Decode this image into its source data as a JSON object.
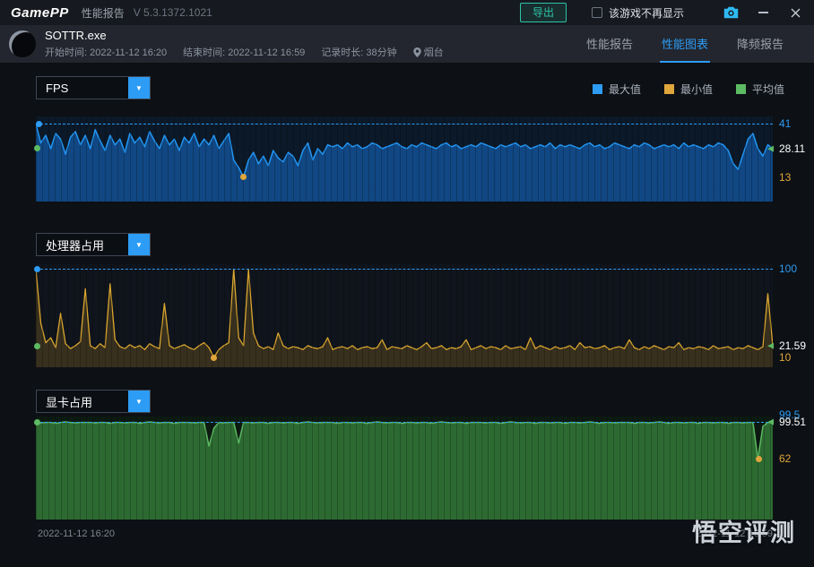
{
  "titlebar": {
    "logo": "GamePP",
    "app_label": "性能报告",
    "version": "V 5.3.1372.1021",
    "export_label": "导出",
    "hide_game_label": "该游戏不再显示"
  },
  "header": {
    "game_name": "SOTTR.exe",
    "start_time": "开始时间: 2022-11-12 16:20",
    "end_time": "结束时间: 2022-11-12 16:59",
    "duration": "记录时长: 38分钟",
    "location": "烟台",
    "tabs": [
      {
        "label": "性能报告",
        "active": false
      },
      {
        "label": "性能图表",
        "active": true
      },
      {
        "label": "降频报告",
        "active": false
      }
    ]
  },
  "selectors": [
    {
      "value": "FPS"
    },
    {
      "value": "处理器占用"
    },
    {
      "value": "显卡占用"
    }
  ],
  "legend": {
    "items": [
      {
        "label": "最大值",
        "color": "#2d9cf4"
      },
      {
        "label": "最小值",
        "color": "#e0a63c"
      },
      {
        "label": "平均值",
        "color": "#5dbb63"
      }
    ]
  },
  "x_axis": {
    "left": "2022-11-12 16:20",
    "right": "2022-11-12 16:59"
  },
  "watermark": "悟空评测",
  "chart_data": [
    {
      "type": "area",
      "title": "FPS",
      "stats": {
        "max": 41,
        "min": 13,
        "avg": 28.11
      },
      "ylim": [
        0,
        45
      ],
      "bg": "#0c1929",
      "line_color": "#2196f3",
      "fill_color": "rgba(21,101,192,0.6)",
      "dash_value": 41,
      "dash_color": "#2d9cf4",
      "axis_labels": [
        {
          "text": "41",
          "value": 41,
          "color": "#2d9cf4"
        },
        {
          "text": "28.11",
          "value": 28.11,
          "color": "#ffffff",
          "arrow": true
        },
        {
          "text": "13",
          "value": 13,
          "color": "#e0a63c"
        }
      ],
      "dots": [
        {
          "value": 41,
          "x_frac": 0.004,
          "color": "#2d9cf4"
        },
        {
          "value": 28.11,
          "x_frac": 0.002,
          "color": "#5dbb63"
        },
        {
          "value": 13,
          "x_frac": 0.282,
          "color": "#e0a63c"
        }
      ],
      "values": [
        41,
        31,
        35,
        28,
        36,
        33,
        25,
        34,
        37,
        30,
        35,
        28,
        38,
        32,
        27,
        35,
        30,
        33,
        26,
        36,
        31,
        34,
        29,
        37,
        32,
        28,
        35,
        30,
        33,
        27,
        34,
        31,
        36,
        29,
        33,
        30,
        35,
        28,
        32,
        36,
        22,
        18,
        13,
        22,
        26,
        20,
        24,
        19,
        27,
        23,
        21,
        26,
        24,
        19,
        27,
        31,
        22,
        28,
        25,
        30,
        29,
        30,
        28,
        31,
        29,
        30,
        28,
        29,
        31,
        30,
        28,
        29,
        30,
        31,
        29,
        28,
        30,
        29,
        31,
        30,
        29,
        28,
        30,
        31,
        29,
        30,
        28,
        29,
        30,
        29,
        31,
        30,
        29,
        28,
        30,
        29,
        30,
        31,
        29,
        30,
        28,
        29,
        30,
        29,
        31,
        28,
        30,
        29,
        30,
        29,
        28,
        30,
        31,
        29,
        30,
        28,
        29,
        31,
        30,
        29,
        28,
        30,
        29,
        31,
        30,
        28,
        29,
        30,
        29,
        30,
        28,
        31,
        29,
        30,
        29,
        28,
        30,
        29,
        31,
        30,
        27,
        20,
        17,
        25,
        33,
        36,
        28,
        24,
        30,
        28
      ]
    },
    {
      "type": "line",
      "title": "处理器占用",
      "stats": {
        "max": 100,
        "min": 10,
        "avg": 21.59
      },
      "ylim": [
        0,
        105
      ],
      "bg": "#10141c",
      "line_color": "#d9a62e",
      "fill_color": "rgba(200,150,40,0.22)",
      "dash_value": 100,
      "dash_color": "#2d9cf4",
      "axis_labels": [
        {
          "text": "100",
          "value": 100,
          "color": "#2d9cf4"
        },
        {
          "text": "21.59",
          "value": 21.59,
          "color": "#ffffff",
          "arrow": true
        },
        {
          "text": "10",
          "value": 10,
          "color": "#e0a63c"
        }
      ],
      "dots": [
        {
          "value": 100,
          "x_frac": 0.002,
          "color": "#2d9cf4"
        },
        {
          "value": 21.59,
          "x_frac": 0.002,
          "color": "#5dbb63"
        },
        {
          "value": 10,
          "x_frac": 0.241,
          "color": "#e0a63c"
        }
      ],
      "values": [
        100,
        45,
        25,
        30,
        20,
        55,
        24,
        19,
        22,
        26,
        80,
        22,
        19,
        24,
        20,
        85,
        28,
        21,
        19,
        23,
        20,
        22,
        18,
        24,
        21,
        19,
        65,
        22,
        19,
        21,
        23,
        20,
        18,
        22,
        25,
        20,
        10,
        18,
        22,
        25,
        100,
        30,
        22,
        100,
        35,
        22,
        19,
        21,
        18,
        35,
        22,
        19,
        21,
        20,
        18,
        22,
        20,
        19,
        21,
        30,
        18,
        20,
        21,
        19,
        22,
        18,
        20,
        21,
        19,
        20,
        28,
        18,
        21,
        20,
        19,
        22,
        20,
        18,
        21,
        25,
        19,
        20,
        22,
        18,
        20,
        19,
        21,
        28,
        18,
        20,
        22,
        19,
        21,
        20,
        18,
        22,
        19,
        20,
        21,
        18,
        30,
        19,
        22,
        20,
        18,
        21,
        19,
        20,
        22,
        18,
        25,
        20,
        21,
        19,
        20,
        22,
        18,
        20,
        21,
        19,
        28,
        20,
        18,
        21,
        19,
        22,
        20,
        18,
        21,
        20,
        25,
        18,
        20,
        19,
        21,
        20,
        18,
        22,
        19,
        20,
        21,
        18,
        20,
        19,
        22,
        20,
        18,
        21,
        75,
        22
      ]
    },
    {
      "type": "area",
      "title": "显卡占用",
      "stats": {
        "max": 99.5,
        "min": 62,
        "avg": 99.51
      },
      "ylim": [
        0,
        105
      ],
      "bg": "#0d1a12",
      "line_color": "#5cb860",
      "fill_color": "rgba(67,160,71,0.6)",
      "dash_value": 99.51,
      "dash_color": "#2d9cf4",
      "axis_labels": [
        {
          "text": "99.5",
          "value": 99.5,
          "color": "#2d9cf4",
          "dy": -8
        },
        {
          "text": "99.51",
          "value": 99.51,
          "color": "#ffffff",
          "arrow": true
        },
        {
          "text": "62",
          "value": 62,
          "color": "#e0a63c"
        }
      ],
      "dots": [
        {
          "value": 99.51,
          "x_frac": 0.002,
          "color": "#5dbb63"
        },
        {
          "value": 62,
          "x_frac": 0.981,
          "color": "#e0a63c"
        }
      ],
      "values": [
        99,
        98.5,
        99,
        99,
        98,
        99,
        99.5,
        99,
        98.5,
        99,
        99,
        99,
        98.5,
        99,
        99,
        98,
        99,
        99,
        98.5,
        99,
        99,
        98,
        99,
        99.5,
        99,
        98.5,
        99,
        99,
        98,
        99,
        99,
        99,
        98.5,
        99,
        99,
        75,
        93,
        99,
        98.5,
        99,
        99,
        78,
        99,
        99,
        98.5,
        99,
        99,
        98,
        99,
        99,
        98.5,
        99,
        99,
        98,
        99,
        99.5,
        99,
        98.5,
        99,
        99,
        99,
        98,
        99,
        99,
        98.5,
        99,
        99,
        98,
        99,
        99.5,
        99,
        98.5,
        99,
        99,
        98,
        99,
        99,
        98.5,
        99,
        99,
        98,
        99,
        99.5,
        99,
        98.5,
        99,
        99,
        98,
        99,
        99,
        99,
        98.5,
        99,
        99,
        98,
        99,
        99.5,
        99,
        98.5,
        99,
        99,
        98,
        99,
        99,
        98.5,
        99,
        99,
        98,
        99,
        99,
        98.5,
        99,
        99.5,
        99,
        98,
        99,
        99,
        98.5,
        99,
        99,
        99,
        98,
        99,
        99,
        98.5,
        99,
        99.5,
        99,
        98,
        99,
        99,
        98.5,
        99,
        99,
        98,
        99,
        99,
        98.5,
        99,
        99,
        98,
        99,
        99,
        98.5,
        99,
        99,
        62,
        95,
        99,
        99
      ]
    }
  ]
}
